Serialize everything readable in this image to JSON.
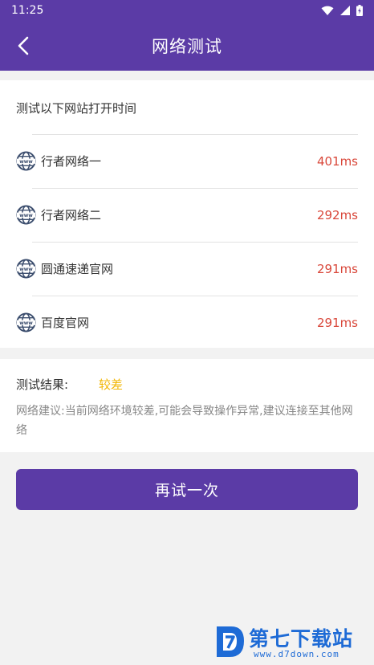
{
  "status_bar": {
    "time": "11:25",
    "icons": [
      "wifi-icon",
      "cellular-signal-icon",
      "battery-icon"
    ]
  },
  "header": {
    "title": "网络测试",
    "back_icon": "chevron-left-icon"
  },
  "sites": {
    "heading": "测试以下网站打开时间",
    "items": [
      {
        "name": "行者网络一",
        "time": "401ms",
        "icon": "www-globe-icon"
      },
      {
        "name": "行者网络二",
        "time": "292ms",
        "icon": "www-globe-icon"
      },
      {
        "name": "圆通速递官网",
        "time": "291ms",
        "icon": "www-globe-icon"
      },
      {
        "name": "百度官网",
        "time": "291ms",
        "icon": "www-globe-icon"
      }
    ]
  },
  "result": {
    "label": "测试结果:",
    "value": "较差",
    "advice": "网络建议:当前网络环境较差,可能会导致操作异常,建议连接至其他网络"
  },
  "actions": {
    "retry_label": "再试一次"
  },
  "watermark": {
    "text": "第七下载站",
    "url": "www.d7down.com"
  },
  "colors": {
    "primary": "#5b3ba6",
    "time_text": "#d9483b",
    "result_value": "#f2b705",
    "watermark": "#1e6bd6"
  }
}
